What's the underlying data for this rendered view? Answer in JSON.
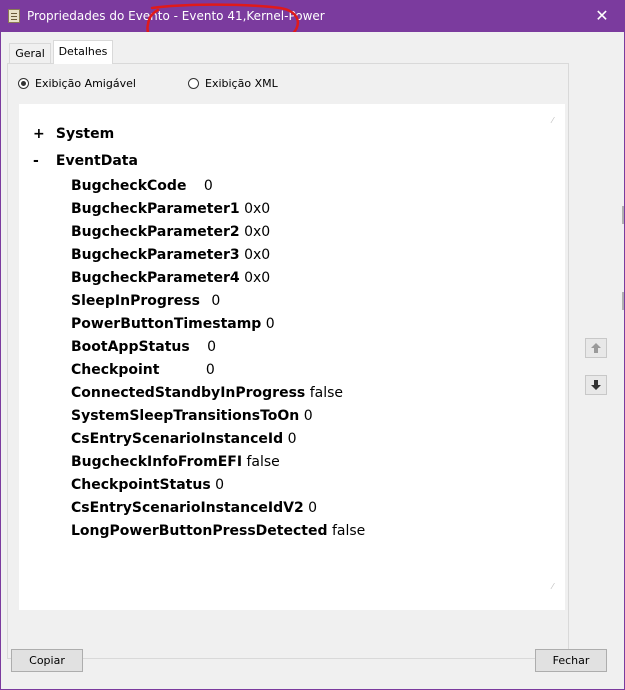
{
  "window": {
    "title": "Propriedades do Evento - Evento 41,Kernel-Power",
    "close_glyph": "✕",
    "accent_color": "#7b3b9e",
    "annotation_color": "#e01a1a"
  },
  "tabs": [
    {
      "label": "Geral",
      "selected": false
    },
    {
      "label": "Detalhes",
      "selected": true
    }
  ],
  "view_options": [
    {
      "label": "Exibição Amigável",
      "checked": true
    },
    {
      "label": "Exibição XML",
      "checked": false
    }
  ],
  "tree": {
    "system": {
      "toggle": "+",
      "label": "System"
    },
    "eventdata": {
      "toggle": "-",
      "label": "EventData"
    },
    "rows": [
      {
        "key": "BugcheckCode",
        "value": "0"
      },
      {
        "key": "BugcheckParameter1",
        "value": "0x0"
      },
      {
        "key": "BugcheckParameter2",
        "value": "0x0"
      },
      {
        "key": "BugcheckParameter3",
        "value": "0x0"
      },
      {
        "key": "BugcheckParameter4",
        "value": "0x0"
      },
      {
        "key": "SleepInProgress",
        "value": "0"
      },
      {
        "key": "PowerButtonTimestamp",
        "value": "0"
      },
      {
        "key": "BootAppStatus",
        "value": "0"
      },
      {
        "key": "Checkpoint",
        "value": "0"
      },
      {
        "key": "ConnectedStandbyInProgress",
        "value": "false"
      },
      {
        "key": "SystemSleepTransitionsToOn",
        "value": "0"
      },
      {
        "key": "CsEntryScenarioInstanceId",
        "value": "0"
      },
      {
        "key": "BugcheckInfoFromEFI",
        "value": "false"
      },
      {
        "key": "CheckpointStatus",
        "value": "0"
      },
      {
        "key": "CsEntryScenarioInstanceIdV2",
        "value": "0"
      },
      {
        "key": "LongPowerButtonPressDetected",
        "value": "false"
      }
    ]
  },
  "buttons": {
    "copy": "Copiar",
    "close": "Fechar"
  },
  "icons": {
    "up": "arrow-up-icon",
    "down": "arrow-down-icon"
  }
}
